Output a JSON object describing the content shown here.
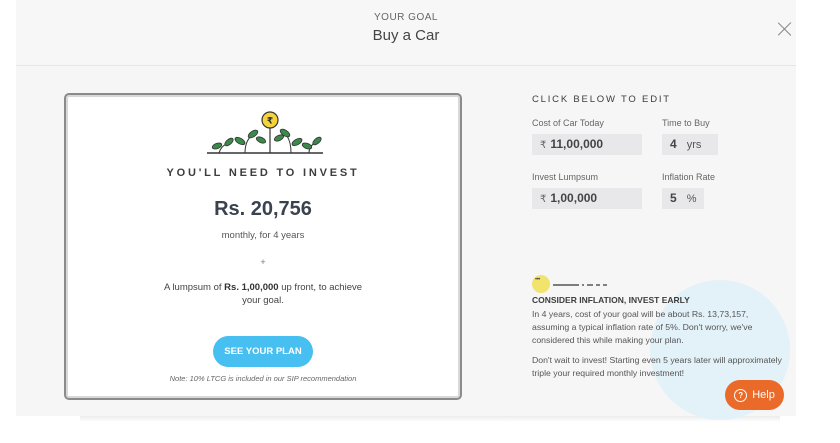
{
  "header": {
    "eyebrow": "YOUR GOAL",
    "title": "Buy a Car",
    "close_icon": "close-icon"
  },
  "invest_card": {
    "icon": "plant-rupee-icon",
    "need_label": "YOU'LL NEED TO INVEST",
    "amount": "Rs. 20,756",
    "monthly": "monthly, for 4 years",
    "plus": "+",
    "lumpsum_prefix": "A lumpsum of ",
    "lumpsum_amount": "Rs. 1,00,000",
    "lumpsum_suffix": " up front, to achieve your goal.",
    "plan_button": "SEE YOUR PLAN",
    "note": "Note: 10% LTCG is included in our SIP recommendation"
  },
  "edit_panel": {
    "title": "CLICK BELOW TO EDIT",
    "cost_label": "Cost of Car Today",
    "cost_prefix": "₹",
    "cost_value": "11,00,000",
    "time_label": "Time to Buy",
    "time_value": "4",
    "time_unit": "yrs",
    "lumpsum_label": "Invest Lumpsum",
    "lumpsum_prefix": "₹",
    "lumpsum_value": "1,00,000",
    "inflation_label": "Inflation Rate",
    "inflation_value": "5",
    "inflation_unit": "%"
  },
  "insight": {
    "icon": "lightbulb-icon",
    "title": "CONSIDER INFLATION, INVEST EARLY",
    "para1": "In 4 years, cost of your goal will be about Rs. 13,73,157, assuming a typical inflation rate of 5%. Don't worry, we've considered this while making your plan.",
    "para2": "Don't wait to invest! Starting even 5 years later will approximately triple your required monthly investment!"
  },
  "help_button": {
    "icon_glyph": "?",
    "label": "Help"
  },
  "colors": {
    "accent_blue": "#47bff0",
    "help_orange": "#ea6a2a",
    "bulb_yellow": "#f2e36d",
    "coin_yellow": "#f5d33a",
    "leaf_green": "#3a8a4a"
  }
}
